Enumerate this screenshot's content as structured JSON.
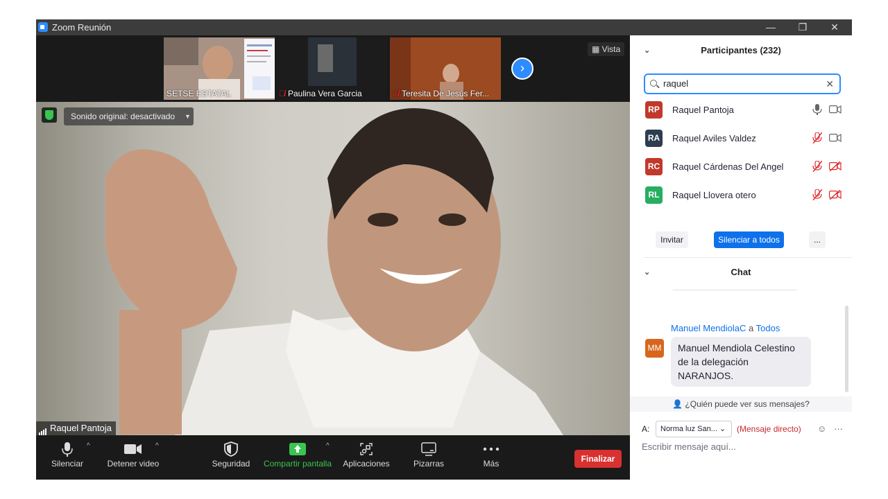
{
  "window": {
    "title": "Zoom Reunión",
    "minimize": "—",
    "maximize": "❐",
    "close": "✕"
  },
  "strip": {
    "thumbs": [
      {
        "label": "SETSE ESTATAL",
        "muted": false
      },
      {
        "label": "Paulina Vera Garcia",
        "muted": true
      },
      {
        "label": "Teresita De Jesús Fer...",
        "muted": true
      }
    ],
    "view_label": "Vista"
  },
  "main_video": {
    "sound_label": "Sonido original: desactivado",
    "speaker": "Raquel Pantoja"
  },
  "toolbar": {
    "mute": "Silenciar",
    "stop_video": "Detener video",
    "security": "Seguridad",
    "share": "Compartir pantalla",
    "apps": "Aplicaciones",
    "whiteboards": "Pizarras",
    "more": "Más",
    "end": "Finalizar",
    "share_color": "#39c54f",
    "end_color": "#d93030"
  },
  "participants": {
    "title": "Participantes (232)",
    "search_value": "raquel",
    "list": [
      {
        "initials": "RP",
        "name": "Raquel Pantoja",
        "color": "#c0392b",
        "mic_muted": false,
        "cam_off": false
      },
      {
        "initials": "RA",
        "name": "Raquel Aviles Valdez",
        "color": "#2c3e50",
        "mic_muted": true,
        "cam_off": false
      },
      {
        "initials": "RC",
        "name": "Raquel Cárdenas Del Angel",
        "color": "#c0392b",
        "mic_muted": true,
        "cam_off": true
      },
      {
        "initials": "RL",
        "name": "Raquel Llovera otero",
        "color": "#27ae60",
        "mic_muted": true,
        "cam_off": true
      }
    ],
    "invite": "Invitar",
    "mute_all": "Silenciar a todos",
    "more": "..."
  },
  "chat": {
    "title": "Chat",
    "sender": "Manuel MendiolaC",
    "to_word": "a",
    "recipient": "Todos",
    "avatar_initials": "MM",
    "message_lines": [
      "Manuel Mendiola Celestino",
      "de la delegación",
      "NARANJOS."
    ],
    "who_sees": "¿Quién puede ver sus mensajes?",
    "to_label": "A:",
    "to_target": "Norma luz San...",
    "direct_label": "(Mensaje directo)",
    "placeholder": "Escribir mensaje aquí..."
  }
}
